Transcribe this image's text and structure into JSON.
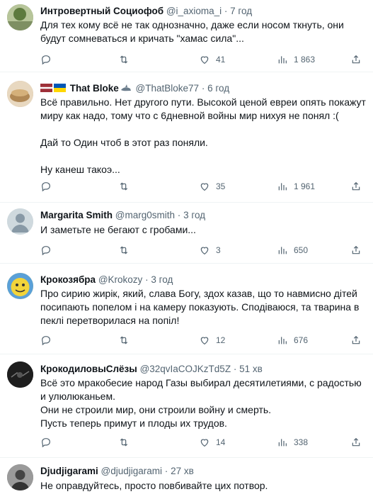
{
  "tweets": [
    {
      "name": "Интровертный Социофоб",
      "handle": "@i_axioma_i",
      "dot": "·",
      "time": "7 год",
      "text": "Для тех кому всё не так однозначно, даже если носом ткнуть, они будут сомневаться и кричать \"хамас сила\"...",
      "reply_count": "",
      "retweet_count": "",
      "like_count": "41",
      "view_count": "1 863",
      "avatar_color": "#8a9a6e"
    },
    {
      "name": "That Bloke",
      "handle": "@ThatBloke77",
      "dot": "·",
      "time": "6 год",
      "text": "Всё правильно. Нет другого пути. Высокой ценой евреи опять покажут миру как надо, тому что с 6дневной войны мир нихуя не понял :(\n\nДай то Один чтоб в этот раз поняли.\n\nНу канеш такоэ...",
      "reply_count": "",
      "retweet_count": "",
      "like_count": "35",
      "view_count": "1 961",
      "avatar_color": "#c9a77c"
    },
    {
      "name": "Margarita Smith",
      "handle": "@marg0smith",
      "dot": "·",
      "time": "3 год",
      "text": "И заметьте не бегают с гробами...",
      "reply_count": "",
      "retweet_count": "",
      "like_count": "3",
      "view_count": "650",
      "avatar_color": "#cfd9de"
    },
    {
      "name": "Крокозябра",
      "handle": "@Krokozy",
      "dot": "·",
      "time": "3 год",
      "text": "Про сирию жирік, який, слава Богу, здох казав, що то навмисно дітей посипають попелом і на камеру показують. Сподіваюся, та тварина в пеклі перетворилася на попіл!",
      "reply_count": "",
      "retweet_count": "",
      "like_count": "12",
      "view_count": "676",
      "avatar_color": "#f2d43a"
    },
    {
      "name": "КрокодиловыСлёзы",
      "handle": "@32qvIaCOJKzTd5Z",
      "dot": "·",
      "time": "51 хв",
      "text": "Всё это мракобесие народ Газы выбирал десятилетиями, с радостью и улюлюканьем.\nОни не строили мир, они строили войну и смерть.\nПусть теперь примут и плоды их трудов.",
      "reply_count": "",
      "retweet_count": "",
      "like_count": "14",
      "view_count": "338",
      "avatar_color": "#1e1e1e"
    },
    {
      "name": "Djudjigarami",
      "handle": "@djudjigarami",
      "dot": "·",
      "time": "27 хв",
      "text": "Не оправдуйтесь, просто повбивайте цих потвор.",
      "avatar_color": "#6b6b6b"
    }
  ]
}
